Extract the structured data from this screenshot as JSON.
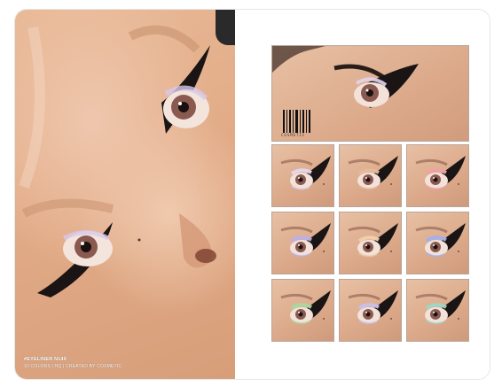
{
  "caption": {
    "title": "#EYELINER N140",
    "subtitle": "10 COLORS | HQ | CREATED BY COSMETIC"
  },
  "hero": {
    "brand": "COSMETIC"
  },
  "swatches": [
    {
      "shimmer": "#e6d6ee"
    },
    {
      "shimmer": "#e7b89a"
    },
    {
      "shimmer": "#f0a0a8"
    },
    {
      "shimmer": "#b8b0ec"
    },
    {
      "shimmer": "#f0cfae"
    },
    {
      "shimmer": "#9fb0f0"
    },
    {
      "shimmer": "#a7d8a0"
    },
    {
      "shimmer": "#c6c0f0"
    },
    {
      "shimmer": "#98d8c8"
    }
  ],
  "colors": {
    "skin": "#e2ab87",
    "liner": "#1a1414",
    "iris": "#8a5a50",
    "frame_border": "#b8a599"
  }
}
